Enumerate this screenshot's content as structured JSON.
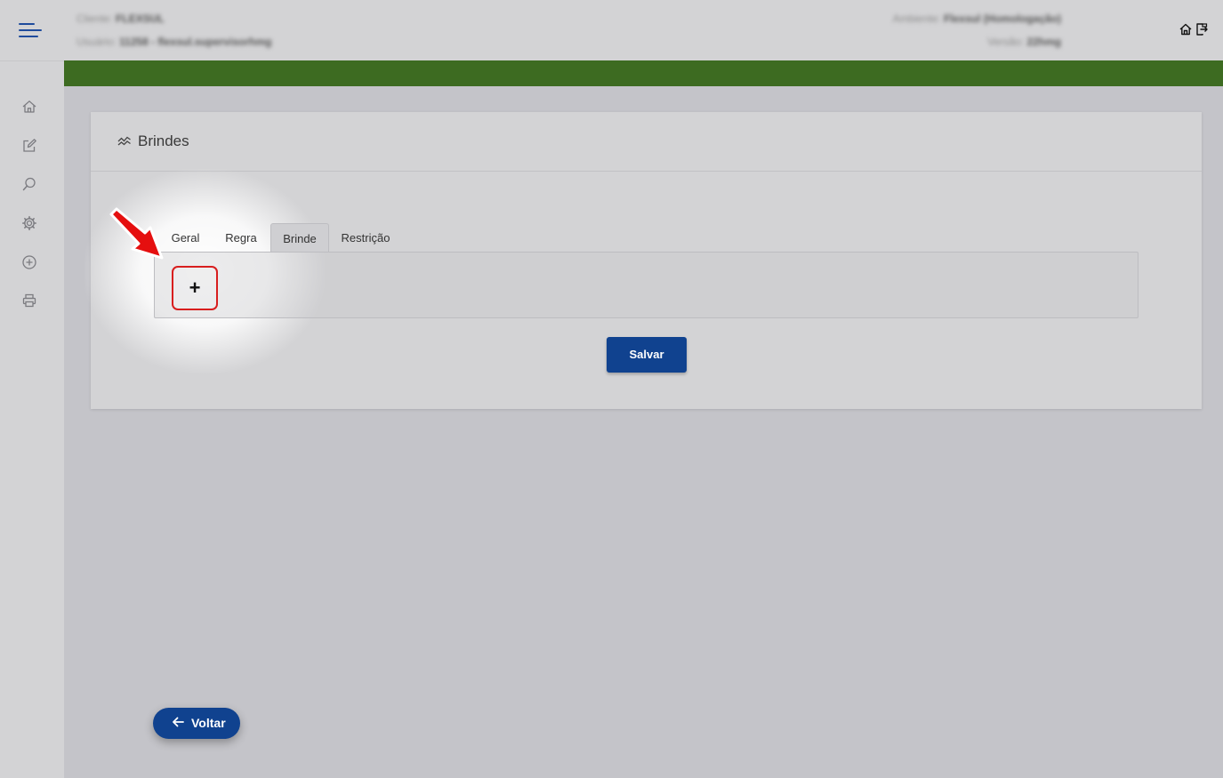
{
  "header": {
    "cliente_label": "Cliente:",
    "cliente_value": "FLEXSUL",
    "usuario_label": "Usuário:",
    "usuario_value": "11258 - flexsul.supervisorhmg",
    "ambiente_label": "Ambiente:",
    "ambiente_value": "Flexsul (Homologação)",
    "versao_label": "Versão:",
    "versao_value": "22hmg",
    "icons": [
      "home-icon",
      "logout-icon"
    ]
  },
  "sidebar": {
    "items": [
      {
        "name": "home-icon"
      },
      {
        "name": "edit-icon"
      },
      {
        "name": "search-icon"
      },
      {
        "name": "gear-icon"
      },
      {
        "name": "add-circle-icon"
      },
      {
        "name": "print-icon"
      }
    ]
  },
  "card": {
    "title": "Brindes",
    "title_icon": "chart-icon"
  },
  "tabs": [
    {
      "label": "Geral",
      "active": false
    },
    {
      "label": "Regra",
      "active": false
    },
    {
      "label": "Brinde",
      "active": true
    },
    {
      "label": "Restrição",
      "active": false
    }
  ],
  "panel": {
    "add_label": "+"
  },
  "actions": {
    "save_label": "Salvar",
    "back_label": "Voltar"
  },
  "colors": {
    "accent": "#10428f",
    "green_bar": "#3d6b21",
    "highlight": "#d81e1e"
  }
}
